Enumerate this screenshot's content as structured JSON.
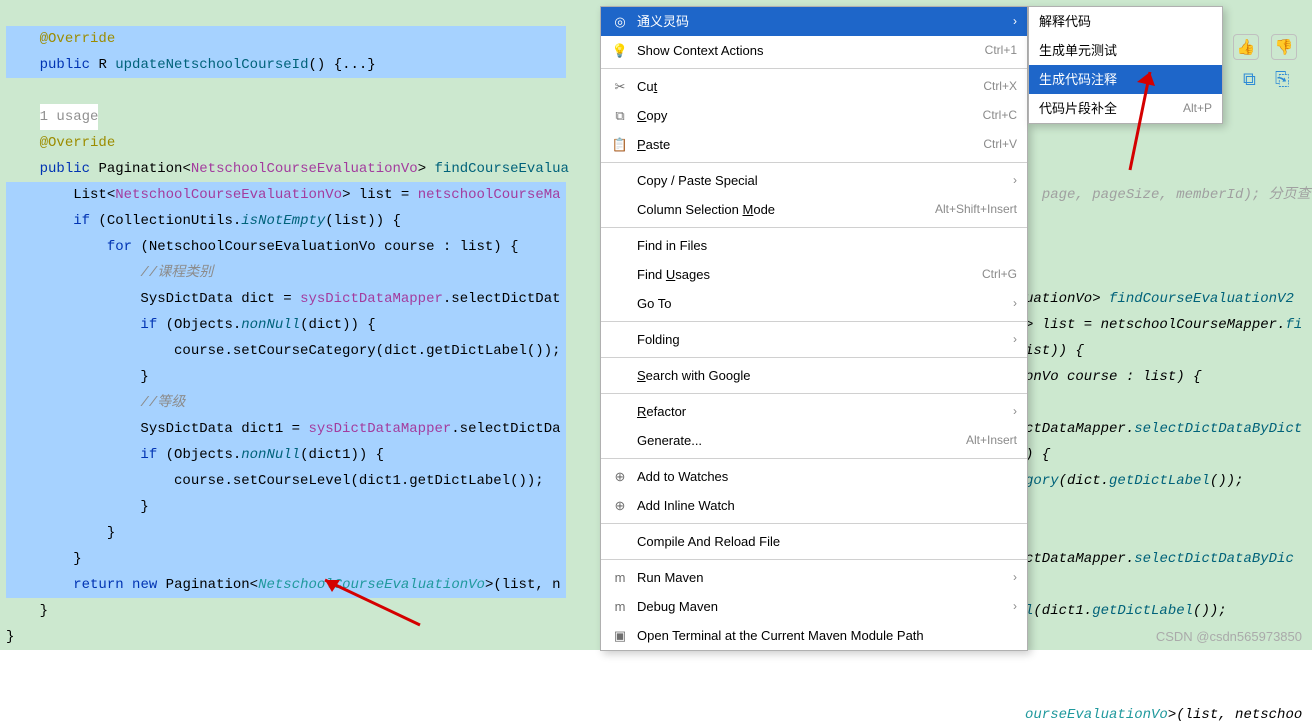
{
  "code": {
    "ann": "@Override",
    "pub": "public",
    "ret_R": "R",
    "updateMethod": "updateNetschoolCourseId",
    "parensEmpty": "()",
    "foldBody": " {...}",
    "usage": "1 usage",
    "pag_open": "Pagination<",
    "gen1": "NetschoolCourseEvaluationVo",
    "close_gt": ">",
    "findMethod": "findCourseEvalua",
    "listDecl": "List<",
    "listVar": "> list = ",
    "mapper1": "netschoolCourseMa",
    "ifLine": "if",
    "collNotEmpty": " (CollectionUtils.",
    "isNotEmpty": "isNotEmpty",
    "listArg": "(list)) {",
    "forkw": "for",
    "forArgs": " (NetschoolCourseEvaluationVo course : list) {",
    "cmt1": "//课程类别",
    "dictDecl": "SysDictData dict = ",
    "dictMapper": "sysDictDataMapper",
    "selectDict": ".selectDictDat",
    "objNonNull": " (Objects.",
    "nonNull": "nonNull",
    "dictArg": "(dict)) {",
    "setCat": "course.setCourseCategory(dict.getDictLabel());",
    "closeBrace": "}",
    "cmt2": "//等级",
    "dict1Decl": "SysDictData dict1 = ",
    "selectDict1": ".selectDictDa",
    "dict1Arg": "(dict1)) {",
    "setLvl": "course.setCourseLevel(dict1.getDictLabel());",
    "return": "return",
    "newkw": "new",
    "pagNew": " Pagination<",
    "pagArgs": ">(list, n",
    "hint1": "page, pageSize, memberId);",
    "hint2": " 分页查询条件",
    "r1": "uationVo",
    "r1b": "> ",
    "r1c": "findCourseEvaluationV2",
    "r2a": "> list = netschoolCourseMapper.",
    "r2b": "fi",
    "r3": "ist)) {",
    "r4": "onVo course : list) {",
    "r5a": "ctDataMapper",
    "r5b": ".",
    "r5c": "selectDictDataByDict",
    "r6": ") {",
    "r7a": "gory",
    "r7b": "(dict.",
    "r7c": "getDictLabel",
    "r7d": "());",
    "r8a": "ctDataMapper",
    "r8b": ".",
    "r8c": "selectDictDataByDic",
    "r10a": "l",
    "r10b": "(dict1.",
    "r10c": "getDictLabel",
    "r10d": "());",
    "r11a": "ourseEvaluationVo",
    "r11b": ">(list, netschoo"
  },
  "menu": {
    "tongyi": "通义灵码",
    "items": [
      {
        "icon": "💡",
        "label": "Show Context Actions",
        "shortcut": "Ctrl+1",
        "arrow": ""
      },
      {
        "icon": "✂",
        "label": "Cu",
        "u": "t",
        "shortcut": "Ctrl+X"
      },
      {
        "icon": "⧉",
        "label": "",
        "u": "C",
        "post": "opy",
        "shortcut": "Ctrl+C"
      },
      {
        "icon": "📋",
        "label": "",
        "u": "P",
        "post": "aste",
        "shortcut": "Ctrl+V"
      },
      {
        "icon": "",
        "label": "Copy / Paste Special",
        "arrow": "›"
      },
      {
        "icon": "",
        "label": "Column Selection ",
        "u": "M",
        "post": "ode",
        "shortcut": "Alt+Shift+Insert"
      },
      {
        "icon": "",
        "label": "Find in Files"
      },
      {
        "icon": "",
        "label": "Find ",
        "u": "U",
        "post": "sages",
        "shortcut": "Ctrl+G"
      },
      {
        "icon": "",
        "label": "Go To",
        "arrow": "›"
      },
      {
        "icon": "",
        "label": "Folding",
        "arrow": "›"
      },
      {
        "icon": "",
        "label": "",
        "u": "S",
        "post": "earch with Google"
      },
      {
        "icon": "",
        "label": "",
        "u": "R",
        "post": "efactor",
        "arrow": "›"
      },
      {
        "icon": "",
        "label": "Generate...",
        "shortcut": "Alt+Insert"
      },
      {
        "icon": "⊕",
        "label": "Add to Watches"
      },
      {
        "icon": "⊕",
        "label": "Add Inline Watch"
      },
      {
        "icon": "",
        "label": "Compile And Reload File"
      },
      {
        "icon": "m",
        "label": "Run Maven",
        "arrow": "›"
      },
      {
        "icon": "m",
        "label": "Debug Maven",
        "arrow": "›"
      },
      {
        "icon": "▣",
        "label": "Open Terminal at the Current Maven Module Path"
      }
    ]
  },
  "submenu": {
    "items": [
      {
        "label": "解释代码"
      },
      {
        "label": "生成单元测试"
      },
      {
        "label": "生成代码注释",
        "selected": true
      },
      {
        "label": "代码片段补全",
        "shortcut": "Alt+P"
      }
    ]
  },
  "watermark": "CSDN @csdn565973850"
}
